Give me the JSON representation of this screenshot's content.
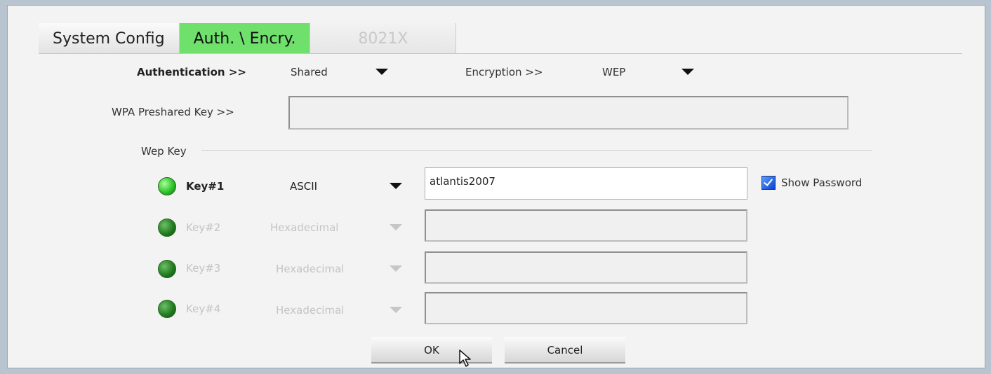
{
  "tabs": [
    {
      "label": "System Config",
      "state": "normal"
    },
    {
      "label": "Auth. \\ Encry.",
      "state": "active"
    },
    {
      "label": "8021X",
      "state": "disabled"
    }
  ],
  "auth": {
    "label": "Authentication >>",
    "value": "Shared",
    "encryption_label": "Encryption >>",
    "encryption_value": "WEP"
  },
  "wpa": {
    "label": "WPA Preshared Key >>",
    "value": ""
  },
  "wep": {
    "group_label": "Wep Key",
    "keys": [
      {
        "label": "Key#1",
        "format": "ASCII",
        "value": "atlantis2007",
        "selected": true
      },
      {
        "label": "Key#2",
        "format": "Hexadecimal",
        "value": "",
        "selected": false
      },
      {
        "label": "Key#3",
        "format": "Hexadecimal",
        "value": "",
        "selected": false
      },
      {
        "label": "Key#4",
        "format": "Hexadecimal",
        "value": "",
        "selected": false
      }
    ],
    "show_password_label": "Show Password",
    "show_password_checked": true
  },
  "buttons": {
    "ok": "OK",
    "cancel": "Cancel"
  },
  "colors": {
    "active_tab": "#6ee06b",
    "led_on": "#2ec42a",
    "checkbox": "#0a3fd0"
  }
}
